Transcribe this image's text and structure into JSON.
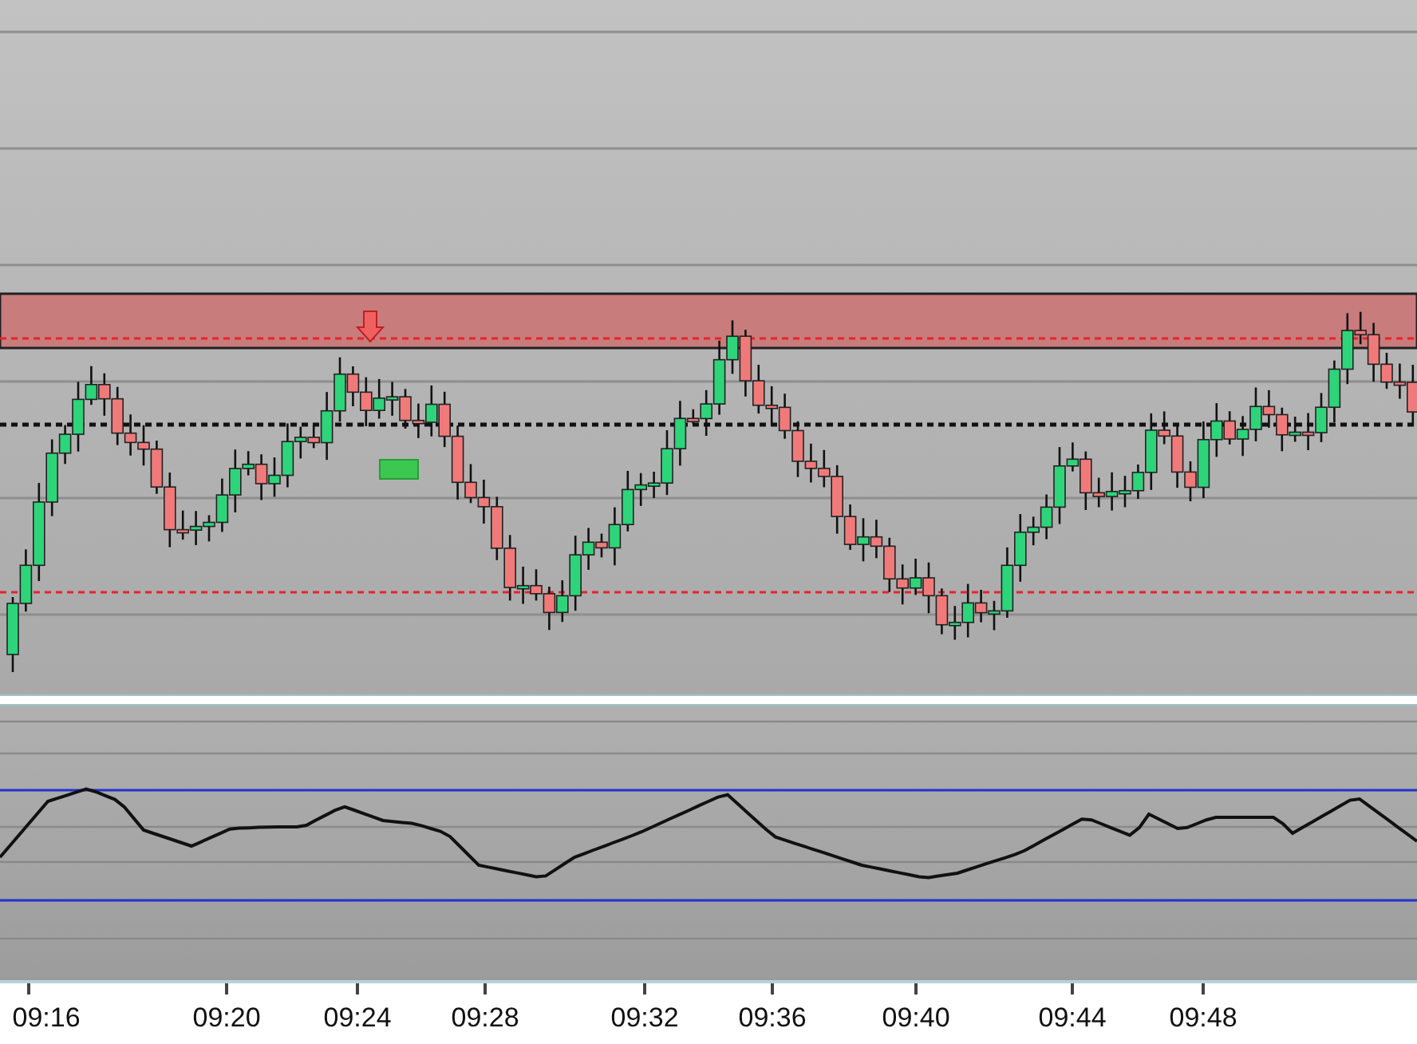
{
  "time_axis": {
    "labels": [
      "09:16",
      "09:20",
      "09:24",
      "09:28",
      "09:32",
      "09:36",
      "09:40",
      "09:44",
      "09:48"
    ]
  }
}
